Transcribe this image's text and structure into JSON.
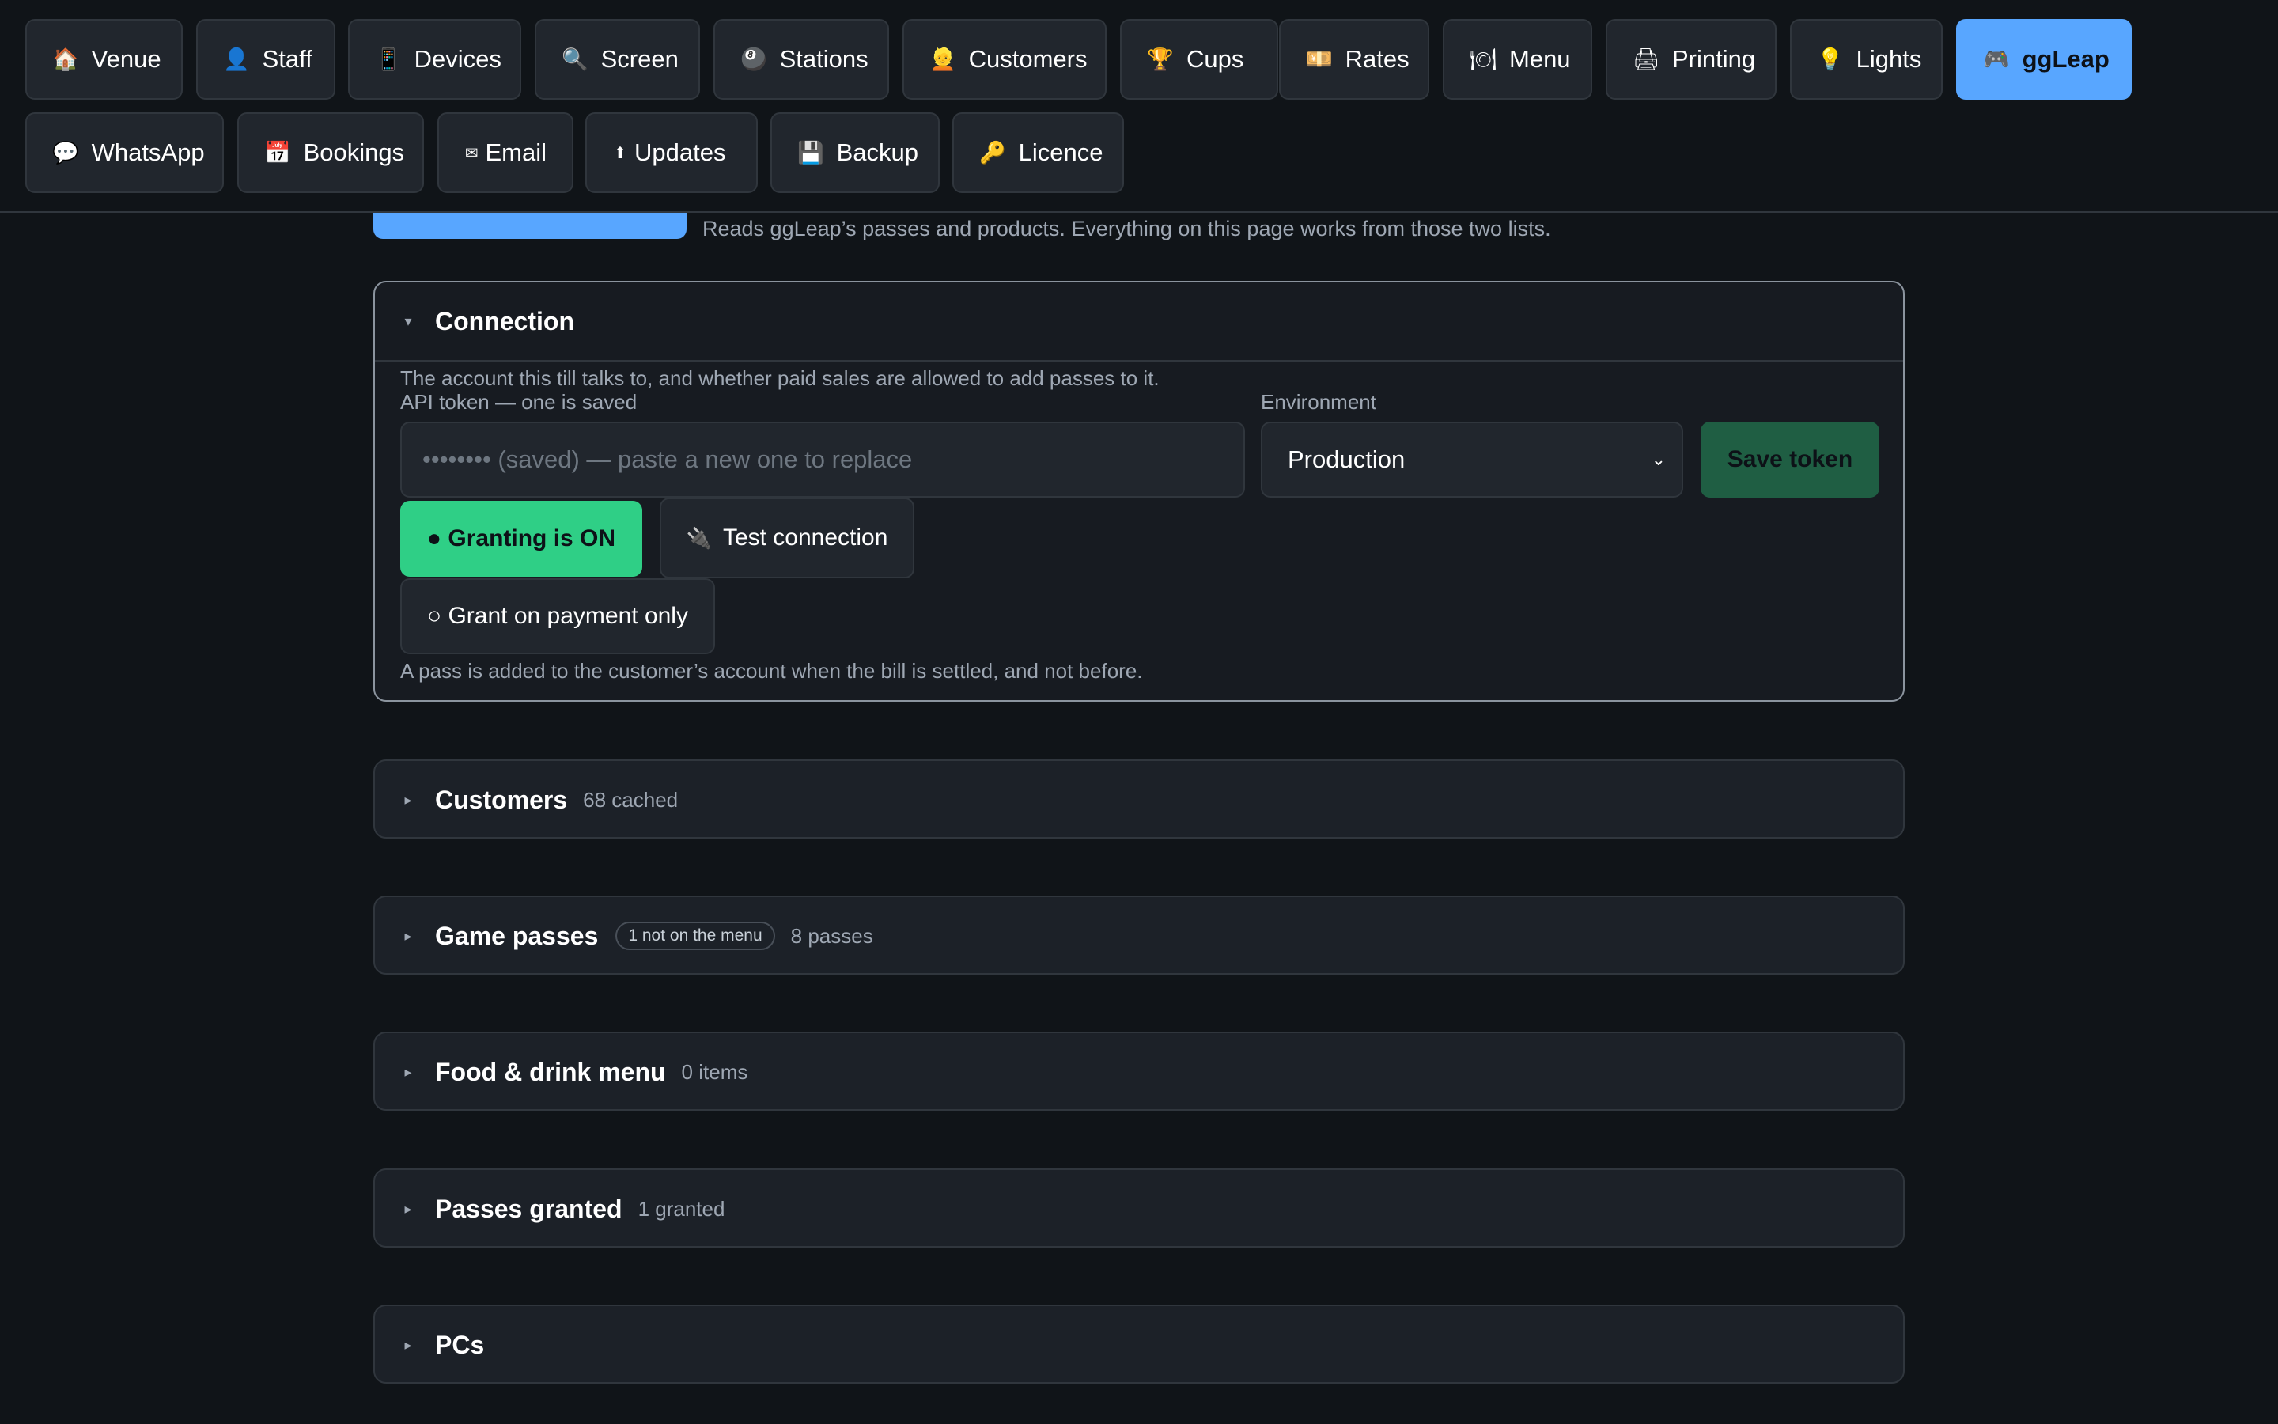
{
  "nav": {
    "row1": [
      {
        "label": "Venue",
        "icon": "🏠",
        "icon_name": "house-icon",
        "key": "venue"
      },
      {
        "label": "Staff",
        "icon": "👤",
        "icon_name": "person-icon",
        "key": "staff"
      },
      {
        "label": "Devices",
        "icon": "📱",
        "icon_name": "phone-icon",
        "key": "devices"
      },
      {
        "label": "Screen",
        "icon": "🔍",
        "icon_name": "magnifier-icon",
        "key": "screen"
      },
      {
        "label": "Stations",
        "icon": "🎱",
        "icon_name": "eight-ball-icon",
        "key": "stations"
      },
      {
        "label": "Customers",
        "icon": "👱",
        "icon_name": "customer-icon",
        "key": "customers"
      },
      {
        "label": "Cups",
        "icon": "🏆",
        "icon_name": "trophy-icon",
        "key": "cups"
      },
      {
        "label": "Rates",
        "icon": "💴",
        "icon_name": "banknote-icon",
        "key": "rates"
      },
      {
        "label": "Menu",
        "icon": "🍽",
        "icon_name": "plate-icon",
        "key": "menu"
      },
      {
        "label": "Printing",
        "icon": "🖨",
        "icon_name": "printer-icon",
        "key": "printing"
      },
      {
        "label": "Lights",
        "icon": "💡",
        "icon_name": "bulb-icon",
        "key": "lights"
      },
      {
        "label": "ggLeap",
        "icon": "🎮",
        "icon_name": "gamepad-icon",
        "key": "ggleap",
        "active": true
      }
    ],
    "row2": [
      {
        "label": "WhatsApp",
        "icon": "💬",
        "icon_name": "speech-bubble-icon",
        "key": "whatsapp"
      },
      {
        "label": "Bookings",
        "icon": "📅",
        "icon_name": "calendar-icon",
        "key": "bookings"
      },
      {
        "label": "Email",
        "icon": "✉",
        "icon_name": "envelope-icon",
        "key": "email"
      },
      {
        "label": "Updates",
        "icon": "⬆",
        "icon_name": "up-arrow-icon",
        "key": "updates"
      },
      {
        "label": "Backup",
        "icon": "💾",
        "icon_name": "floppy-disk-icon",
        "key": "backup"
      },
      {
        "label": "Licence",
        "icon": "🔑",
        "icon_name": "key-icon",
        "key": "licence"
      }
    ]
  },
  "page": {
    "description": "Reads ggLeap’s passes and products. Everything on this page works from those two lists."
  },
  "connection": {
    "title": "Connection",
    "caret": "▾",
    "description": "The account this till talks to, and whether paid sales are allowed to add passes to it.",
    "token_label": "API token — one is saved",
    "token_value": "",
    "token_placeholder": "•••••••• (saved) — paste a new one to replace",
    "environment_label": "Environment",
    "environment_value": "Production",
    "environment_options": [
      "Production"
    ],
    "save_label": "Save token",
    "granting_label": "● Granting is ON",
    "test_label": "Test connection",
    "test_icon": "🔌",
    "grant_mode_label": "○ Grant on payment only",
    "grant_note": "A pass is added to the customer’s account when the bill is settled, and not before."
  },
  "sections": {
    "customers": {
      "title": "Customers",
      "meta": "68 cached",
      "caret": "▸"
    },
    "game_passes": {
      "title": "Game passes",
      "badge": "1 not on the menu",
      "meta": "8 passes",
      "caret": "▸"
    },
    "food_menu": {
      "title": "Food & drink menu",
      "meta": "0 items",
      "caret": "▸"
    },
    "passes_granted": {
      "title": "Passes granted",
      "meta": "1 granted",
      "caret": "▸"
    },
    "pcs": {
      "title": "PCs",
      "caret": "▸"
    }
  },
  "colors": {
    "background": "#101418",
    "accent_blue": "#58a6ff",
    "granting_green": "#2fcf86",
    "save_green": "#1f5e43"
  }
}
